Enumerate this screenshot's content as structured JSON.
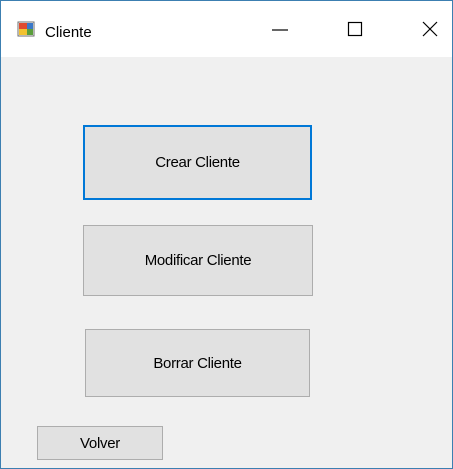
{
  "window": {
    "title": "Cliente",
    "app_icon": "winforms-app-icon",
    "caption_buttons": {
      "minimize_icon": "minimize-icon",
      "maximize_icon": "maximize-icon",
      "close_icon": "close-icon"
    }
  },
  "buttons": {
    "crear": "Crear Cliente",
    "modificar": "Modificar Cliente",
    "borrar": "Borrar Cliente",
    "volver": "Volver"
  },
  "colors": {
    "focus_border": "#0078d7",
    "button_face": "#e1e1e1",
    "window_background": "#f0f0f0"
  }
}
